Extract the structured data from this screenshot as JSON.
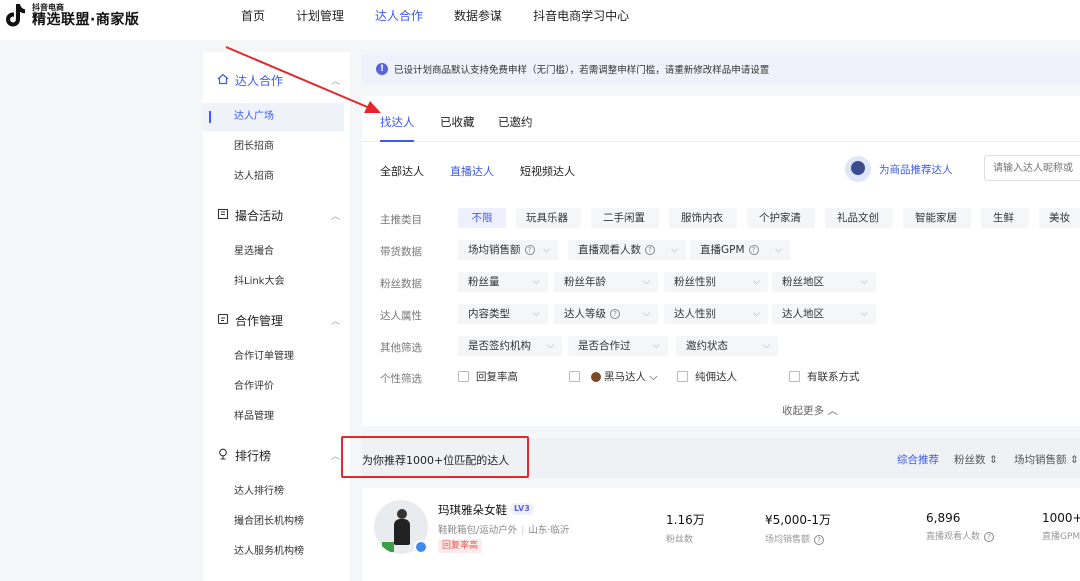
{
  "brand": {
    "small": "抖音电商",
    "main": "精选联盟·商家版"
  },
  "nav": [
    {
      "label": "首页"
    },
    {
      "label": "计划管理"
    },
    {
      "label": "达人合作",
      "active": true
    },
    {
      "label": "数据参谋"
    },
    {
      "label": "抖音电商学习中心"
    }
  ],
  "sidebar": {
    "groups": [
      {
        "label": "达人合作",
        "items": [
          "达人广场",
          "团长招商",
          "达人招商"
        ]
      },
      {
        "label": "撮合活动",
        "items": [
          "星选撮合",
          "抖Link大会"
        ]
      },
      {
        "label": "合作管理",
        "items": [
          "合作订单管理",
          "合作评价",
          "样品管理"
        ]
      },
      {
        "label": "排行榜",
        "items": [
          "达人排行榜",
          "撮合团长机构榜",
          "达人服务机构榜"
        ]
      }
    ]
  },
  "notice": {
    "icon": "!",
    "text": "已设计划商品默认支持免费申样（无门槛），若需调整申样门槛，请重新修改样品申请设置"
  },
  "tabs": [
    "找达人",
    "已收藏",
    "已邀约"
  ],
  "subtabs": [
    "全部达人",
    "直播达人",
    "短视频达人"
  ],
  "recommend_label": "为商品推荐达人",
  "search_placeholder": "请输入达人昵称或",
  "filters": {
    "category": {
      "label": "主推类目",
      "chips": [
        "不限",
        "玩具乐器",
        "二手闲置",
        "服饰内衣",
        "个护家清",
        "礼品文创",
        "智能家居",
        "生鲜",
        "美妆"
      ]
    },
    "sales": {
      "label": "带货数据",
      "chips": [
        "场均销售额",
        "直播观看人数",
        "直播GPM"
      ]
    },
    "fans": {
      "label": "粉丝数据",
      "chips": [
        "粉丝量",
        "粉丝年龄",
        "粉丝性别",
        "粉丝地区"
      ]
    },
    "attrs": {
      "label": "达人属性",
      "chips": [
        "内容类型",
        "达人等级",
        "达人性别",
        "达人地区"
      ]
    },
    "other": {
      "label": "其他筛选",
      "chips": [
        "是否签约机构",
        "是否合作过",
        "邀约状态"
      ]
    },
    "personal": {
      "label": "个性筛选",
      "checks": [
        "回复率高",
        "黑马达人",
        "纯佣达人",
        "有联系方式"
      ]
    },
    "collapse": "收起更多"
  },
  "results": {
    "title": "为你推荐1000+位匹配的达人",
    "sorts": [
      "综合推荐",
      "粉丝数",
      "场均销售额"
    ]
  },
  "influencer": {
    "name": "玛琪雅朵女鞋",
    "level": "LV3",
    "category": "鞋靴箱包/运动户外",
    "location": "山东·临沂",
    "badge": "回复率高",
    "metrics": [
      {
        "value": "1.16万",
        "label": "粉丝数"
      },
      {
        "value": "¥5,000-1万",
        "label": "场均销售额"
      },
      {
        "value": "6,896",
        "label": "直播观看人数"
      },
      {
        "value": "1000+",
        "label": "直播GPM"
      }
    ]
  },
  "colors": {
    "accent": "#3d5af1",
    "annotation": "#e4282b"
  }
}
